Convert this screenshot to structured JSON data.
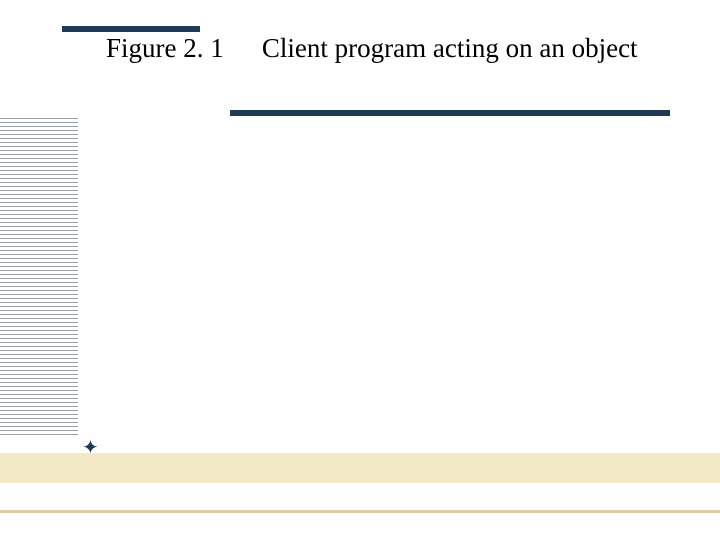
{
  "title": {
    "figure_number": "Figure 2. 1",
    "figure_caption": "Client program acting on an object"
  },
  "decor": {
    "star_glyph": "✦",
    "accent_color": "#203a55",
    "band_color": "#f3e9c6"
  }
}
